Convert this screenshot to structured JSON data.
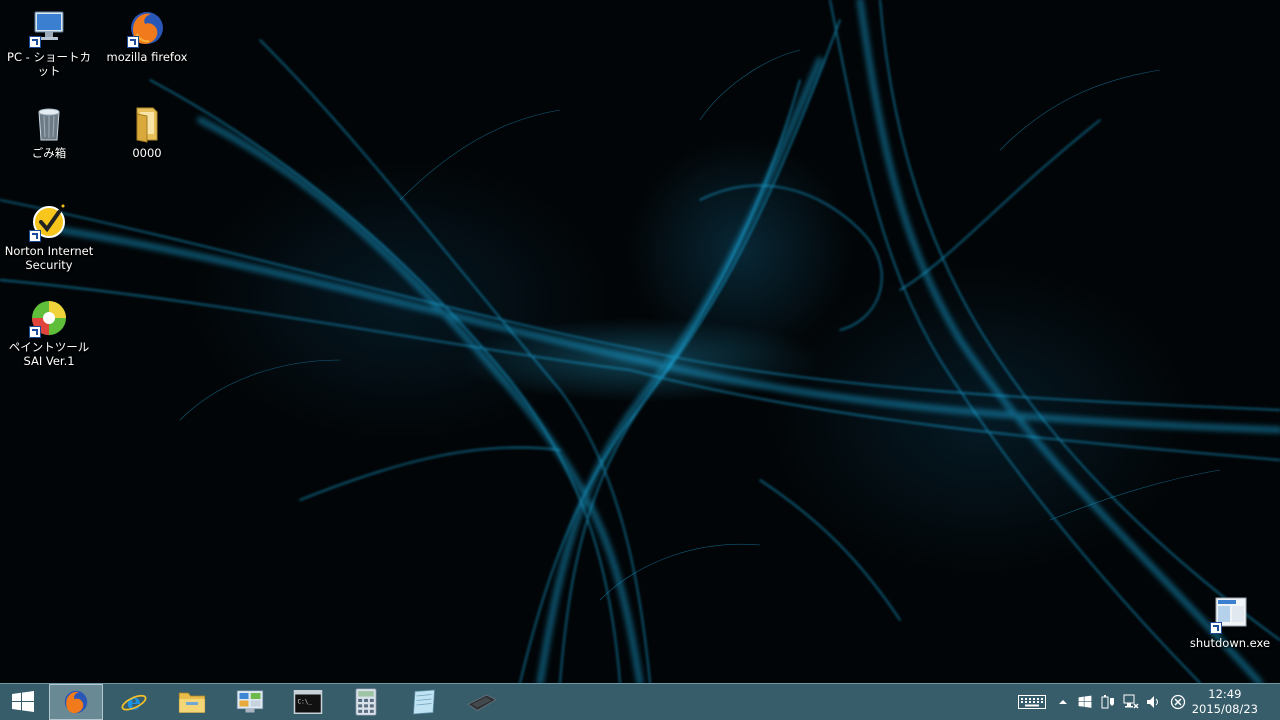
{
  "desktop_icons": [
    {
      "label": "PC - ショートカット",
      "icon": "computer-icon"
    },
    {
      "label": "mozilla firefox",
      "icon": "firefox-icon"
    },
    {
      "label": "ごみ箱",
      "icon": "recycle-bin-icon"
    },
    {
      "label": "0000",
      "icon": "folder-icon"
    },
    {
      "label": "Norton Internet Security",
      "icon": "norton-icon"
    },
    {
      "label": "ペイントツールSAI Ver.1",
      "icon": "sai-icon"
    },
    {
      "label": "shutdown.exe",
      "icon": "shutdown-icon"
    }
  ],
  "taskbar": {
    "pinned": [
      "start-icon",
      "firefox-icon",
      "internet-explorer-icon",
      "file-explorer-icon",
      "control-panel-icon",
      "command-prompt-icon",
      "calculator-icon",
      "notepad-icon",
      "tablet-icon"
    ],
    "clock": {
      "time": "12:49",
      "date": "2015/08/23"
    }
  },
  "colors": {
    "accent": "#2bb8e8",
    "taskbar": "#3c6473"
  }
}
